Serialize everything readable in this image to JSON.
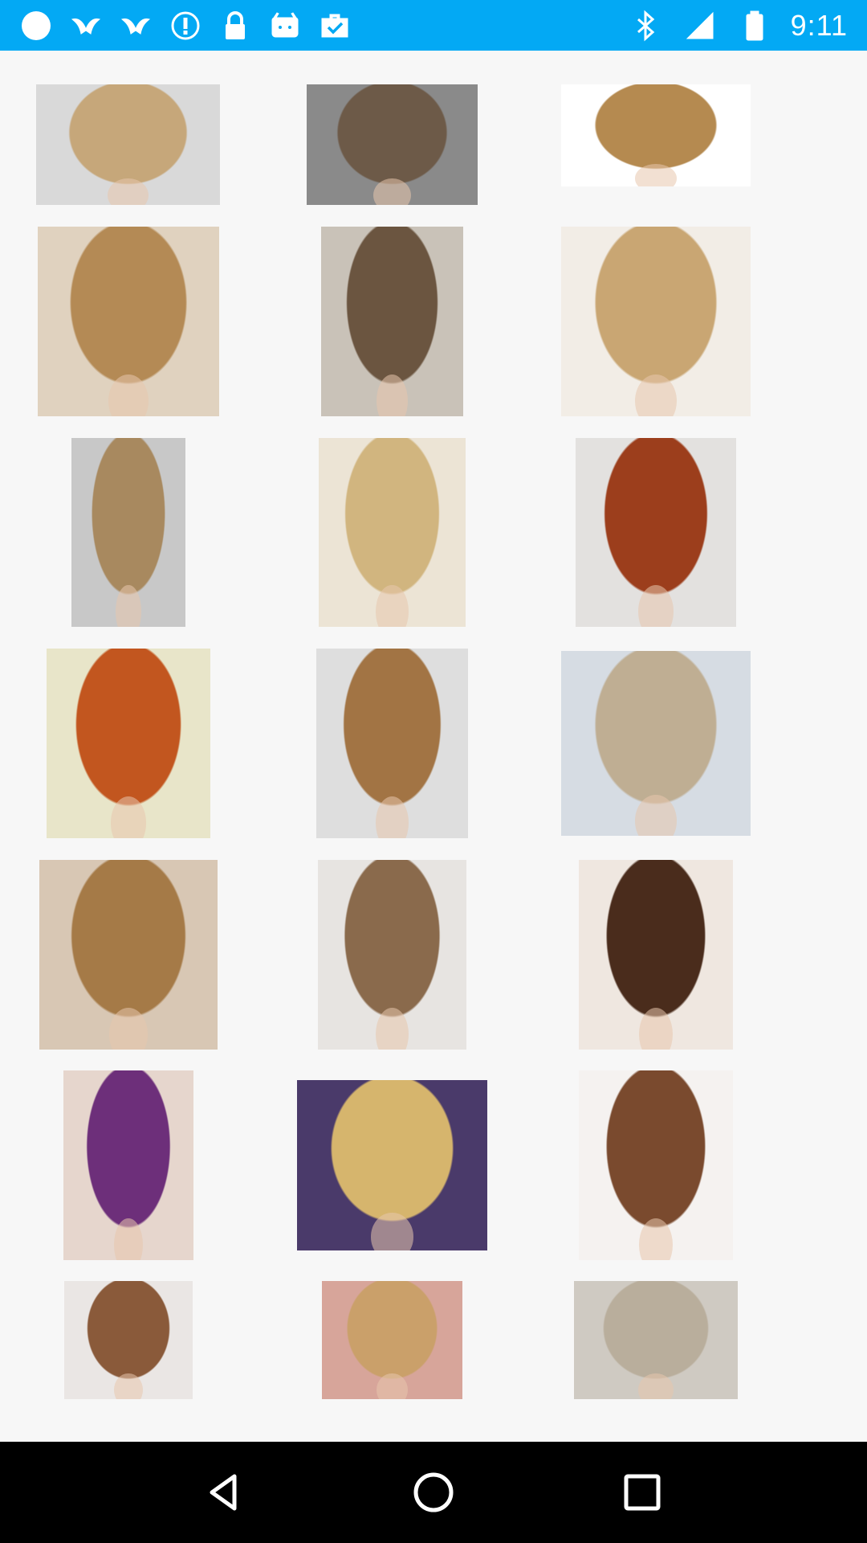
{
  "status_bar": {
    "time": "9:11",
    "left_icons": [
      "circle-icon",
      "bird-icon",
      "bird-icon",
      "alert-icon",
      "lock-icon",
      "android-icon",
      "briefcase-check-icon"
    ],
    "right_icons": [
      "bluetooth-icon",
      "signal-icon",
      "battery-icon"
    ],
    "background": "#03a9f4"
  },
  "gallery": {
    "items": [
      {
        "name": "hairstyle-1",
        "hair": "#c6a77a",
        "bg": "#d9d9d9"
      },
      {
        "name": "hairstyle-2",
        "hair": "#6d5a48",
        "bg": "#8a8a8a"
      },
      {
        "name": "hairstyle-3",
        "hair": "#b58a50",
        "bg": "#ffffff"
      },
      {
        "name": "hairstyle-4",
        "hair": "#b48a55",
        "bg": "#e0d2bf"
      },
      {
        "name": "hairstyle-5",
        "hair": "#6b5540",
        "bg": "#c9c2b8"
      },
      {
        "name": "hairstyle-6",
        "hair": "#c9a673",
        "bg": "#f2ede6"
      },
      {
        "name": "hairstyle-7",
        "hair": "#a8895f",
        "bg": "#c8c8c8"
      },
      {
        "name": "hairstyle-8",
        "hair": "#d1b57f",
        "bg": "#ece4d5"
      },
      {
        "name": "hairstyle-9",
        "hair": "#9c3e1c",
        "bg": "#e3e1df"
      },
      {
        "name": "hairstyle-10",
        "hair": "#c2561f",
        "bg": "#e8e5c9"
      },
      {
        "name": "hairstyle-11",
        "hair": "#a27444",
        "bg": "#dedede"
      },
      {
        "name": "hairstyle-12",
        "hair": "#bfae93",
        "bg": "#d6dce3"
      },
      {
        "name": "hairstyle-13",
        "hair": "#a57a47",
        "bg": "#d8c7b4"
      },
      {
        "name": "hairstyle-14",
        "hair": "#8a6a4c",
        "bg": "#e7e4e1"
      },
      {
        "name": "hairstyle-15",
        "hair": "#4a2c1c",
        "bg": "#efe7e0"
      },
      {
        "name": "hairstyle-16",
        "hair": "#6d2f7a",
        "bg": "#e6d6cd"
      },
      {
        "name": "hairstyle-17",
        "hair": "#d6b56d",
        "bg": "#4a3a6a"
      },
      {
        "name": "hairstyle-18",
        "hair": "#7a4a2e",
        "bg": "#f5f2f0"
      },
      {
        "name": "hairstyle-19",
        "hair": "#8a5a3a",
        "bg": "#eae6e4"
      },
      {
        "name": "hairstyle-20",
        "hair": "#caa06a",
        "bg": "#d7a59a"
      },
      {
        "name": "hairstyle-21",
        "hair": "#b9ae9c",
        "bg": "#cfcac2"
      }
    ]
  },
  "nav_bar": {
    "buttons": [
      "back-icon",
      "home-icon",
      "recents-icon"
    ]
  }
}
